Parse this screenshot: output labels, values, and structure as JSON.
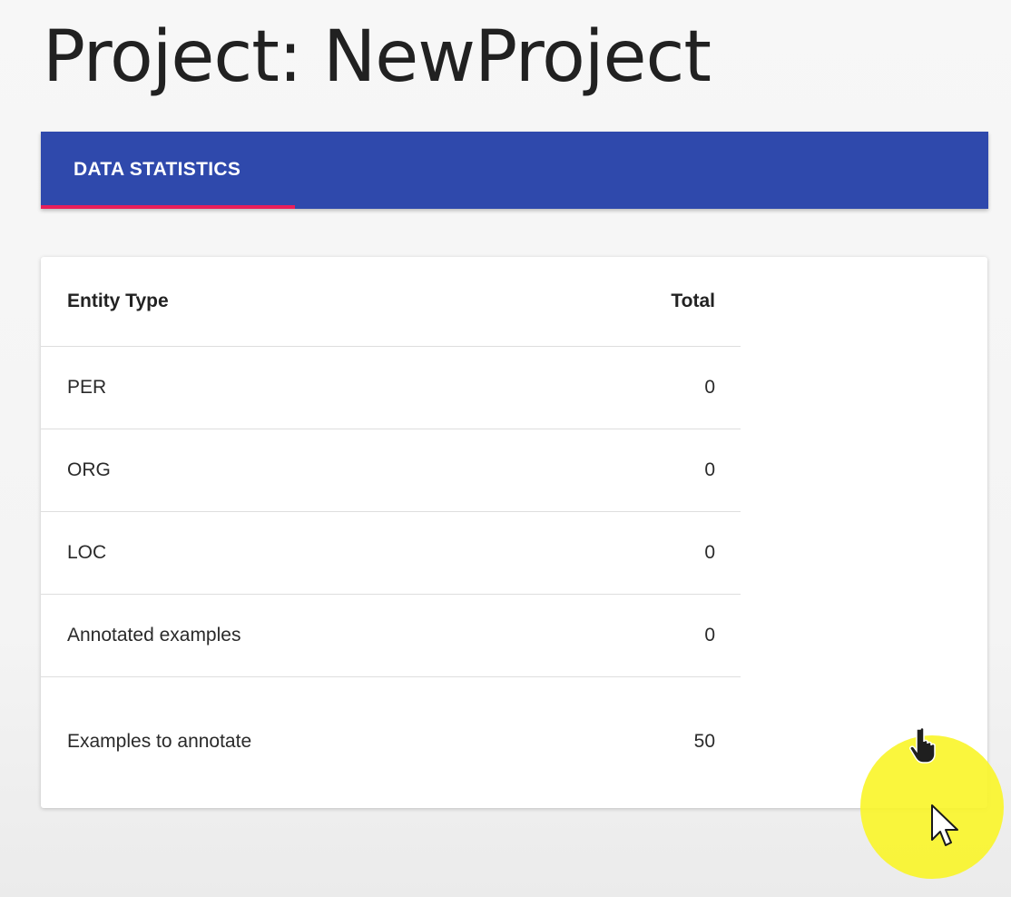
{
  "page": {
    "title": "Project: NewProject"
  },
  "tabs": [
    {
      "label": "DATA STATISTICS",
      "active": true
    }
  ],
  "stats_table": {
    "headers": {
      "label": "Entity Type",
      "value": "Total"
    },
    "rows": [
      {
        "label": "PER",
        "value": "0"
      },
      {
        "label": "ORG",
        "value": "0"
      },
      {
        "label": "LOC",
        "value": "0"
      },
      {
        "label": "Annotated examples",
        "value": "0"
      },
      {
        "label": "Examples to annotate",
        "value": "50"
      }
    ]
  },
  "cursor": {
    "highlight_color": "#faf528",
    "hand_icon": "hand-pointer-icon",
    "arrow_icon": "arrow-pointer-icon"
  },
  "colors": {
    "tab_bar": "#2f49ac",
    "tab_indicator": "#e91e5a"
  }
}
